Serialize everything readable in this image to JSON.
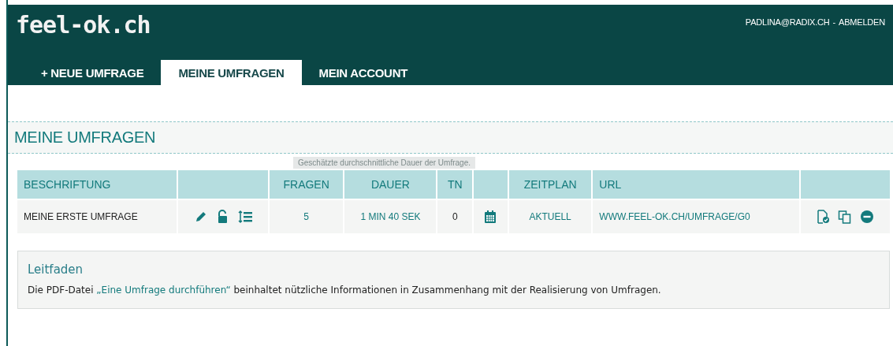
{
  "header": {
    "logo": "feel-ok.ch",
    "user": "PADLINA@RADIX.CH",
    "separator": "-",
    "logout": "ABMELDEN"
  },
  "tabs": [
    {
      "label": "+ NEUE UMFRAGE",
      "selected": false
    },
    {
      "label": "MEINE UMFRAGEN",
      "selected": true
    },
    {
      "label": "MEIN ACCOUNT",
      "selected": false
    }
  ],
  "section_title": "MEINE UMFRAGEN",
  "table": {
    "columns": [
      "BESCHRIFTUNG",
      "",
      "FRAGEN",
      "DAUER",
      "TN",
      "",
      "ZEITPLAN",
      "URL",
      ""
    ],
    "rows": [
      {
        "name": "MEINE ERSTE UMFRAGE",
        "fragen": "5",
        "dauer": "1 MIN 40 SEK",
        "tn": "0",
        "zeitplan": "AKTUELL",
        "url": "WWW.FEEL-OK.CH/UMFRAGE/G0"
      }
    ]
  },
  "tooltip": "Geschätzte durchschnittliche Dauer der Umfrage.",
  "guide": {
    "title": "Leitfaden",
    "text_before": "Die PDF-Datei",
    "link": "„Eine Umfrage durchführen“",
    "text_after": "beinhaltet nützliche Informationen in Zusammenhang mit der Realisierung von Umfragen."
  }
}
